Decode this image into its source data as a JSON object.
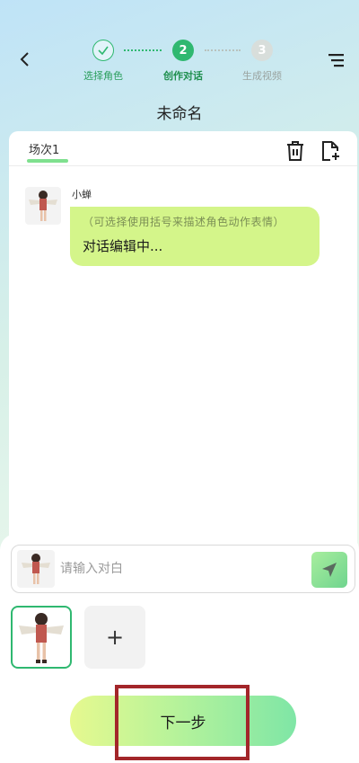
{
  "header": {
    "steps": [
      {
        "label": "选择角色",
        "status": "done"
      },
      {
        "label": "创作对话",
        "number": "2",
        "status": "active"
      },
      {
        "label": "生成视频",
        "number": "3",
        "status": "pending"
      }
    ],
    "title": "未命名"
  },
  "scene": {
    "tab_label": "场次1"
  },
  "dialog": {
    "speaker": "小蝉",
    "hint": "（可选择使用括号来描述角色动作表情）",
    "text": "对话编辑中..."
  },
  "composer": {
    "placeholder": "请输入对白"
  },
  "characters": {
    "add_label": "+"
  },
  "footer": {
    "next_label": "下一步"
  },
  "colors": {
    "accent": "#2fb870",
    "bubble": "#d4f58a",
    "highlight": "#a3262a"
  }
}
